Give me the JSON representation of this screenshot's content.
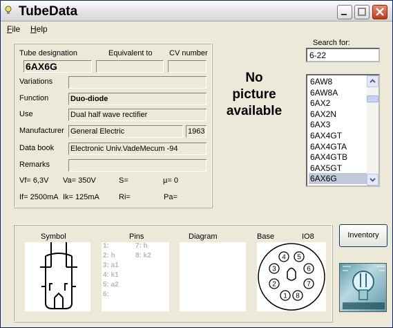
{
  "window": {
    "title": "TubeData"
  },
  "menu": {
    "items": [
      {
        "label": "File",
        "accel": "F",
        "rest": "ile"
      },
      {
        "label": "Help",
        "accel": "H",
        "rest": "elp"
      }
    ]
  },
  "details": {
    "tube_designation_label": "Tube designation",
    "equivalent_label": "Equivalent to",
    "cv_label": "CV number",
    "tube_designation": "6AX6G",
    "equivalent": "",
    "cv_number": "",
    "variations_label": "Variations",
    "variations": "",
    "function_label": "Function",
    "function": "Duo-diode",
    "use_label": "Use",
    "use": "Dual half wave rectifier",
    "manufacturer_label": "Manufacturer",
    "manufacturer": "General Electric",
    "year": "1963",
    "databook_label": "Data book",
    "databook": "Electronic Univ.VadeMecum -94",
    "remarks_label": "Remarks",
    "remarks": "",
    "vf": "Vf= 6,3V",
    "va": "Va=  350V",
    "s": "S=",
    "mu": "µ=    0",
    "if": "If= 2500mA",
    "ik": "Ik=   125mA",
    "ri": "Ri=",
    "pa": "Pa="
  },
  "no_picture": {
    "line1": "No",
    "line2": "picture",
    "line3": "available"
  },
  "search": {
    "label": "Search for:",
    "value": "6-22"
  },
  "tube_list": {
    "items": [
      "6AW8",
      "6AW8A",
      "6AX2",
      "6AX2N",
      "6AX3",
      "6AX4GT",
      "6AX4GTA",
      "6AX4GTB",
      "6AX5GT",
      "6AX6G"
    ],
    "selected": "6AX6G"
  },
  "bottom": {
    "symbol_label": "Symbol",
    "pins_label": "Pins",
    "diagram_label": "Diagram",
    "base_label": "Base",
    "base_type": "IO8",
    "pins_col1": [
      "1:",
      "2: h",
      "3: a1",
      "4: k1",
      "5: a2",
      "6:"
    ],
    "pins_col2": [
      "7: h",
      "8: k2"
    ],
    "base_pins": [
      "1",
      "2",
      "3",
      "4",
      "5",
      "6",
      "7",
      "8"
    ]
  },
  "buttons": {
    "inventory": "Inventory"
  },
  "colors": {
    "selection": "#c1c8d8",
    "close_button": "#c4381c",
    "window_bg": "#ece9d8"
  }
}
